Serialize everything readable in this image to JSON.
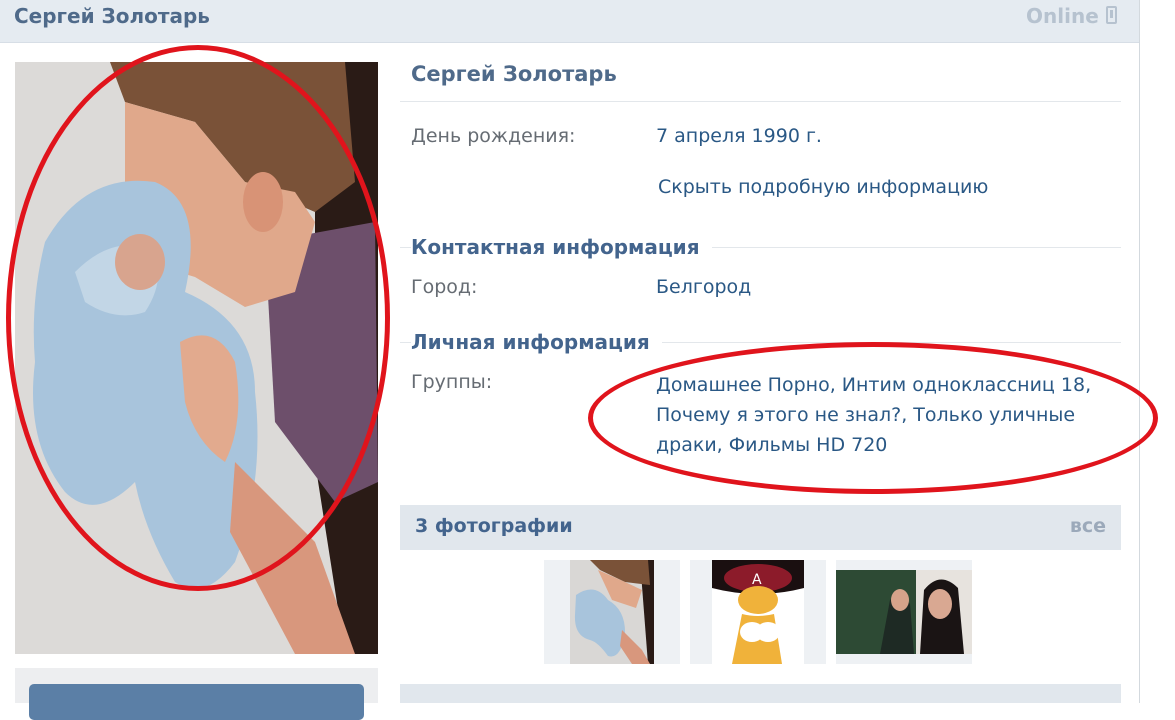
{
  "header": {
    "name": "Сергей Золотарь",
    "status": "Online",
    "status_icon": "mobile-phone-icon"
  },
  "profile": {
    "name": "Сергей Золотарь",
    "birthday_label": "День рождения:",
    "birthday_value": "7 апреля 1990 г.",
    "toggle_details": "Скрыть подробную информацию"
  },
  "contact": {
    "title": "Контактная информация",
    "city_label": "Город:",
    "city_value": "Белгород"
  },
  "personal": {
    "title": "Личная информация",
    "groups_label": "Группы:",
    "groups_value": "Домашнее Порно, Интим одноклассниц 18, Почему я этого не знал?, Только уличные драки, Фильмы HD 720"
  },
  "photos": {
    "title": "3 фотографии",
    "all_link": "все"
  },
  "colors": {
    "accent": "#4f6a8a",
    "link": "#2a5885",
    "annotation": "#e0141c"
  }
}
